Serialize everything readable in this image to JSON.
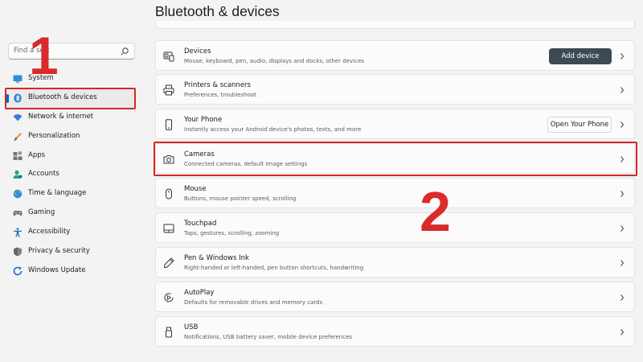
{
  "search": {
    "placeholder": "Find a sett"
  },
  "sidebar": {
    "items": [
      {
        "label": "System",
        "icon": "monitor-icon"
      },
      {
        "label": "Bluetooth & devices",
        "icon": "bluetooth-icon",
        "selected": true
      },
      {
        "label": "Network & internet",
        "icon": "wifi-icon"
      },
      {
        "label": "Personalization",
        "icon": "paintbrush-icon"
      },
      {
        "label": "Apps",
        "icon": "apps-icon"
      },
      {
        "label": "Accounts",
        "icon": "person-icon"
      },
      {
        "label": "Time & language",
        "icon": "globe-clock-icon"
      },
      {
        "label": "Gaming",
        "icon": "gamepad-icon"
      },
      {
        "label": "Accessibility",
        "icon": "accessibility-icon"
      },
      {
        "label": "Privacy & security",
        "icon": "shield-icon"
      },
      {
        "label": "Windows Update",
        "icon": "update-icon"
      }
    ]
  },
  "page": {
    "title": "Bluetooth & devices"
  },
  "cards": [
    {
      "title": "Devices",
      "subtitle": "Mouse, keyboard, pen, audio, displays and docks, other devices",
      "icon": "devices-icon",
      "button": "Add device"
    },
    {
      "title": "Printers & scanners",
      "subtitle": "Preferences, troubleshoot",
      "icon": "printer-icon"
    },
    {
      "title": "Your Phone",
      "subtitle": "Instantly access your Android device's photos, texts, and more",
      "icon": "phone-icon",
      "button": "Open Your Phone"
    },
    {
      "title": "Cameras",
      "subtitle": "Connected cameras, default image settings",
      "icon": "camera-icon"
    },
    {
      "title": "Mouse",
      "subtitle": "Buttons, mouse pointer speed, scrolling",
      "icon": "mouse-icon"
    },
    {
      "title": "Touchpad",
      "subtitle": "Taps, gestures, scrolling, zooming",
      "icon": "touchpad-icon"
    },
    {
      "title": "Pen & Windows Ink",
      "subtitle": "Right-handed or left-handed, pen button shortcuts, handwriting",
      "icon": "pen-icon"
    },
    {
      "title": "AutoPlay",
      "subtitle": "Defaults for removable drives and memory cards",
      "icon": "autoplay-icon"
    },
    {
      "title": "USB",
      "subtitle": "Notifications, USB battery saver, mobile device preferences",
      "icon": "usb-icon"
    }
  ],
  "annotations": {
    "step1": "1",
    "step2": "2",
    "color": "#d92b2b"
  },
  "colors": {
    "accent": "#0067c0",
    "button_dark": "#3d4a53",
    "highlight_red": "#d72626"
  }
}
